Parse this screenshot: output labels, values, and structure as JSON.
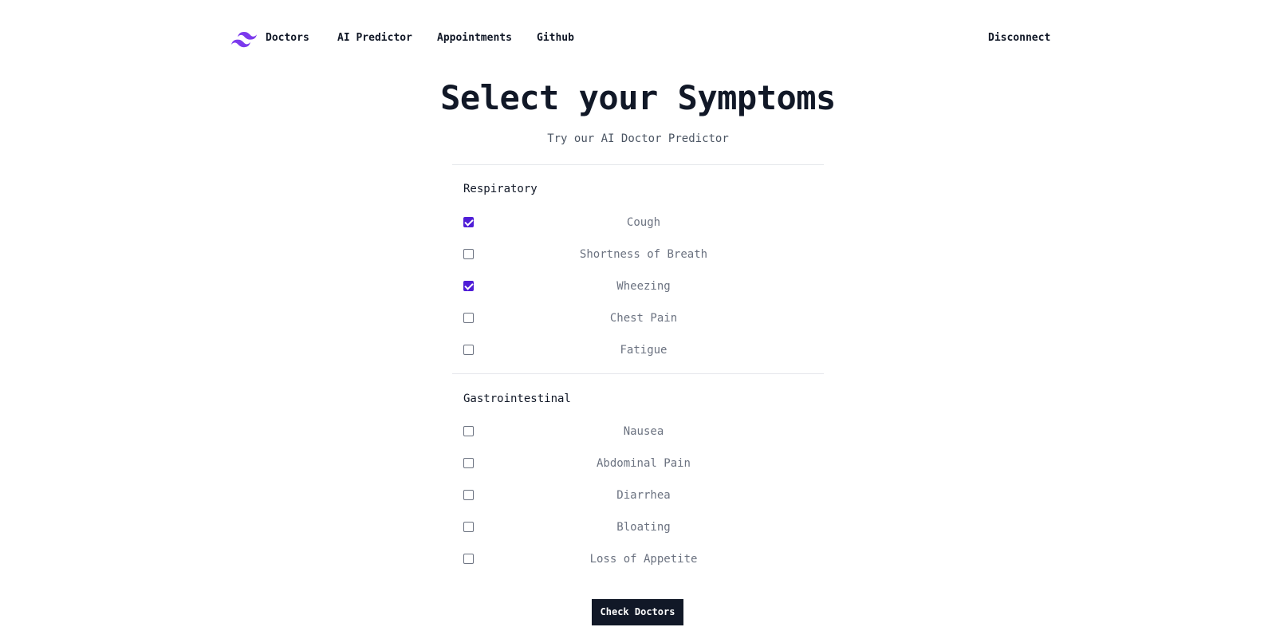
{
  "nav": {
    "logo_icon": "tailwind-logo-icon",
    "logo_color": "#7c3aed",
    "doctors": "Doctors",
    "ai_predictor": "AI Predictor",
    "appointments": "Appointments",
    "github": "Github",
    "disconnect": "Disconnect"
  },
  "main": {
    "title": "Select your Symptoms",
    "subtitle": "Try our AI Doctor Predictor",
    "accent_color": "#4f1dd7",
    "sections": [
      {
        "heading": "Respiratory",
        "symptoms": [
          {
            "label": "Cough",
            "checked": true
          },
          {
            "label": "Shortness of Breath",
            "checked": false
          },
          {
            "label": "Wheezing",
            "checked": true
          },
          {
            "label": "Chest Pain",
            "checked": false
          },
          {
            "label": "Fatigue",
            "checked": false
          }
        ]
      },
      {
        "heading": "Gastrointestinal",
        "symptoms": [
          {
            "label": "Nausea",
            "checked": false
          },
          {
            "label": "Abdominal Pain",
            "checked": false
          },
          {
            "label": "Diarrhea",
            "checked": false
          },
          {
            "label": "Bloating",
            "checked": false
          },
          {
            "label": "Loss of Appetite",
            "checked": false
          }
        ]
      }
    ],
    "submit_label": "Check Doctors"
  }
}
